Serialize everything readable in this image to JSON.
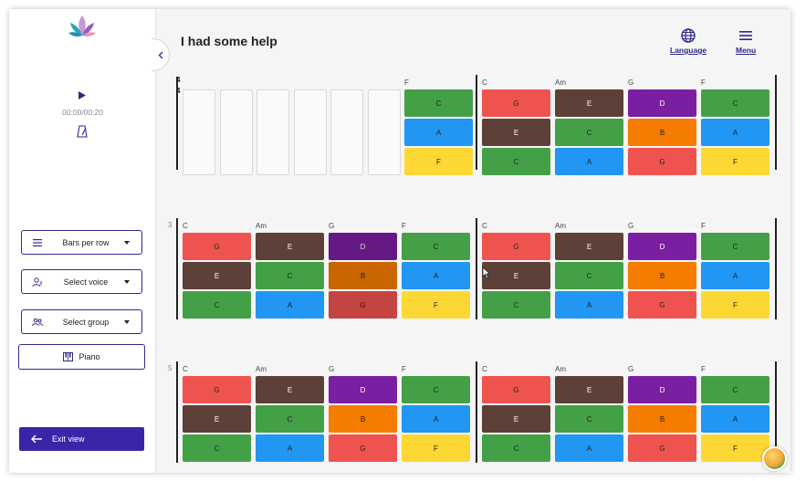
{
  "player": {
    "time": "00:00/00:20"
  },
  "sidebar": {
    "bars_per_row": "Bars per row",
    "select_voice": "Select voice",
    "select_group": "Select group",
    "piano": "Piano",
    "exit_view": "Exit view"
  },
  "header": {
    "title": "I had some help",
    "language": "Language",
    "menu": "Menu"
  },
  "score": {
    "time_signature": [
      "4",
      "4"
    ],
    "row_numbers": [
      "3",
      "5"
    ],
    "colors": {
      "G": "#ef5350",
      "E": "#5d4037",
      "D": "#7b1fa2",
      "C": "#43a047",
      "B": "#f57c00",
      "A": "#2196f3",
      "F": "#fdd835"
    },
    "pickup_bar": {
      "chord": "F",
      "notes": [
        "C",
        "A",
        "F"
      ]
    },
    "bars": [
      {
        "chord": "C",
        "notes": [
          "G",
          "E",
          "C"
        ]
      },
      {
        "chord": "Am",
        "notes": [
          "E",
          "C",
          "A"
        ]
      },
      {
        "chord": "G",
        "notes": [
          "D",
          "B",
          "G"
        ]
      },
      {
        "chord": "F",
        "notes": [
          "C",
          "A",
          "F"
        ]
      }
    ]
  }
}
